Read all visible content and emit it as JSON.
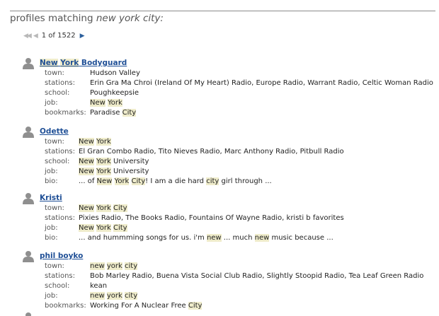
{
  "header": {
    "prefix": "profiles matching ",
    "query": "new york city:"
  },
  "pager": {
    "text": "1 of 1522"
  },
  "profiles": [
    {
      "name": [
        "",
        "New",
        " ",
        "York",
        " Bodyguard"
      ],
      "fields": [
        {
          "label": "town:",
          "parts": [
            "Hudson Valley"
          ]
        },
        {
          "label": "stations:",
          "parts": [
            "Erin Gra Ma Chroi (Ireland Of My Heart) Radio, Europe Radio, Warrant Radio, Celtic Woman Radio"
          ]
        },
        {
          "label": "school:",
          "parts": [
            "Poughkeepsie"
          ]
        },
        {
          "label": "job:",
          "parts": [
            "",
            "New",
            " ",
            "York"
          ]
        },
        {
          "label": "bookmarks:",
          "parts": [
            "Paradise ",
            "City"
          ]
        }
      ]
    },
    {
      "name": [
        "Odette"
      ],
      "fields": [
        {
          "label": "town:",
          "parts": [
            "",
            "New",
            " ",
            "York"
          ]
        },
        {
          "label": "stations:",
          "parts": [
            "El Gran Combo Radio, Tito Nieves Radio, Marc Anthony Radio, Pitbull Radio"
          ]
        },
        {
          "label": "school:",
          "parts": [
            "",
            "New",
            " ",
            "York",
            " University"
          ]
        },
        {
          "label": "job:",
          "parts": [
            "",
            "New",
            " ",
            "York",
            " University"
          ]
        },
        {
          "label": "bio:",
          "parts": [
            "... of ",
            "New",
            " ",
            "York",
            " ",
            "City",
            "! I am a die hard ",
            "city",
            " girl through ..."
          ]
        }
      ]
    },
    {
      "name": [
        "Kristi"
      ],
      "fields": [
        {
          "label": "town:",
          "parts": [
            "",
            "New",
            " ",
            "York",
            " ",
            "City"
          ]
        },
        {
          "label": "stations:",
          "parts": [
            "Pixies Radio, The Books Radio, Fountains Of Wayne Radio, kristi b favorites"
          ]
        },
        {
          "label": "job:",
          "parts": [
            "",
            "New",
            " ",
            "York",
            " ",
            "City"
          ]
        },
        {
          "label": "bio:",
          "parts": [
            "... and hummming songs for us. i'm ",
            "new",
            " ... much ",
            "new",
            " music because ..."
          ]
        }
      ]
    },
    {
      "name": [
        "phil boyko"
      ],
      "fields": [
        {
          "label": "town:",
          "parts": [
            "",
            "new",
            " ",
            "york",
            " ",
            "city"
          ]
        },
        {
          "label": "stations:",
          "parts": [
            "Bob Marley Radio, Buena Vista Social Club Radio, Slightly Stoopid Radio, Tea Leaf Green Radio"
          ]
        },
        {
          "label": "school:",
          "parts": [
            "kean"
          ]
        },
        {
          "label": "job:",
          "parts": [
            "",
            "new",
            " ",
            "york",
            " ",
            "city"
          ]
        },
        {
          "label": "bookmarks:",
          "parts": [
            "Working For A Nuclear Free ",
            "City"
          ]
        }
      ]
    }
  ],
  "icons": {
    "avatar": "person-silhouette-icon",
    "pager_first": "first-page-icon",
    "pager_prev": "prev-page-icon",
    "pager_next": "next-page-icon"
  },
  "colors": {
    "link": "#1f4f96",
    "highlight": "#efeccb",
    "label": "#555555",
    "rule": "#8c8c8c"
  }
}
